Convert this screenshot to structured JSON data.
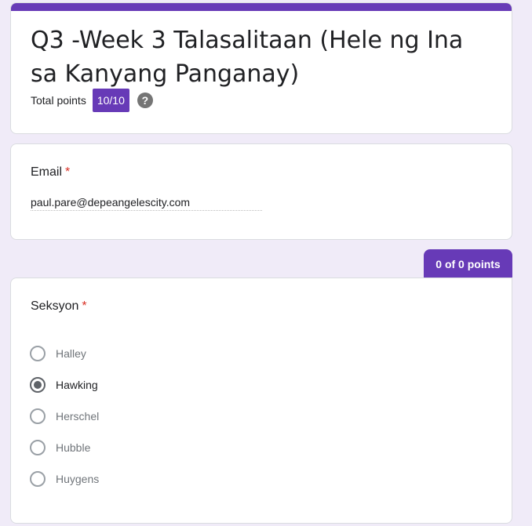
{
  "header": {
    "title": "Q3 -Week 3 Talasalitaan (Hele ng Ina sa Kanyang Panganay)",
    "total_points_label": "Total points",
    "score": "10/10",
    "help_icon": "help-circle-icon"
  },
  "email_question": {
    "label": "Email",
    "required_mark": "*",
    "value": "paul.pare@depeangelescity.com"
  },
  "section_question": {
    "points_tab": "0 of 0 points",
    "label": "Seksyon",
    "required_mark": "*",
    "selected": "Hawking",
    "options": [
      {
        "label": "Halley",
        "selected": false
      },
      {
        "label": "Hawking",
        "selected": true
      },
      {
        "label": "Herschel",
        "selected": false
      },
      {
        "label": "Hubble",
        "selected": false
      },
      {
        "label": "Huygens",
        "selected": false
      }
    ]
  },
  "colors": {
    "accent": "#673ab7",
    "background": "#f0ebf8",
    "required": "#d93025"
  }
}
